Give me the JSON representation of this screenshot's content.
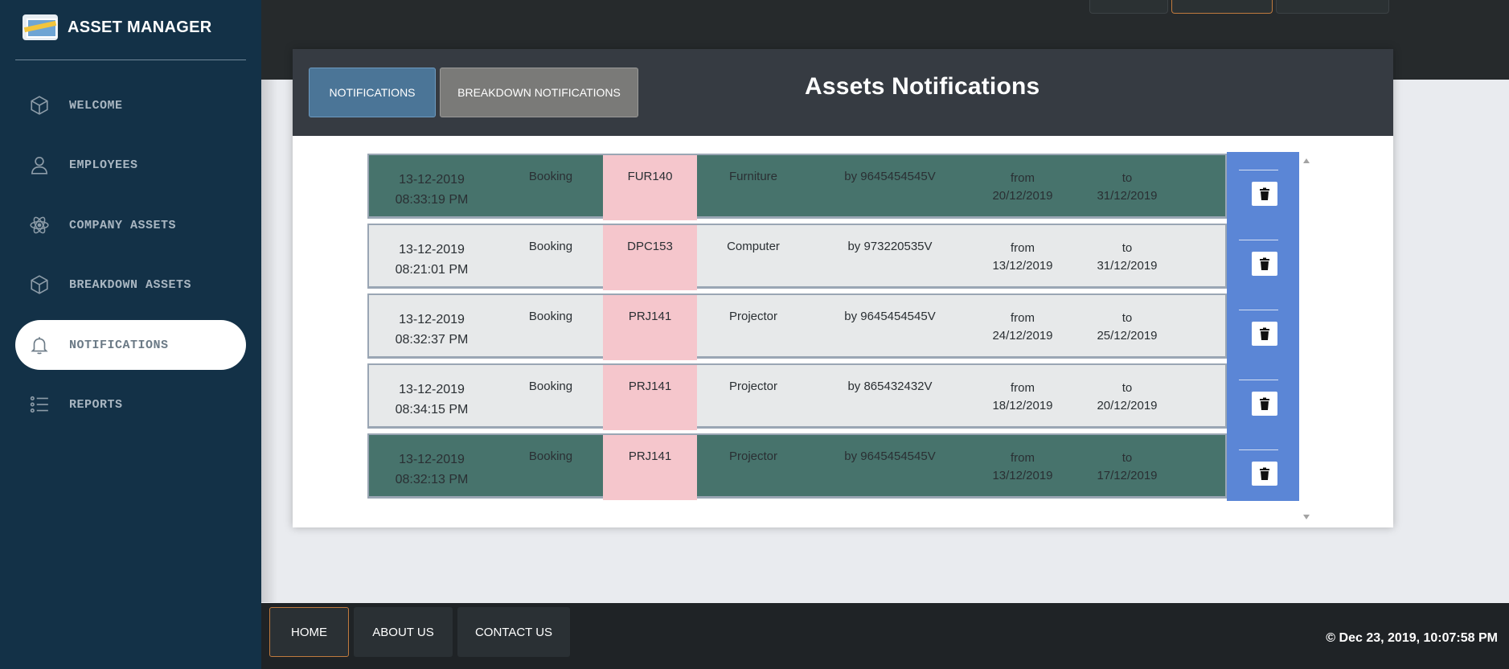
{
  "app": {
    "title": "ASSET MANAGER"
  },
  "sidebar": {
    "items": [
      {
        "label": "WELCOME",
        "icon": "cube-icon"
      },
      {
        "label": "EMPLOYEES",
        "icon": "user-icon"
      },
      {
        "label": "COMPANY ASSETS",
        "icon": "atom-icon"
      },
      {
        "label": "BREAKDOWN ASSETS",
        "icon": "cube-icon"
      },
      {
        "label": "NOTIFICATIONS",
        "icon": "bell-icon",
        "active": true
      },
      {
        "label": "REPORTS",
        "icon": "list-icon"
      }
    ]
  },
  "header": {
    "tabs": [
      {
        "label": "NOTIFICATIONS",
        "active": true
      },
      {
        "label": "BREAKDOWN NOTIFICATIONS"
      }
    ],
    "title": "Assets Notifications"
  },
  "notifications": [
    {
      "date": "13-12-2019",
      "time": "08:33:19 PM",
      "type": "Booking",
      "code": "FUR140",
      "category": "Furniture",
      "by": "by 9645454545V",
      "from_label": "from",
      "from_date": "20/12/2019",
      "to_label": "to",
      "to_date": "31/12/2019",
      "style": "green"
    },
    {
      "date": "13-12-2019",
      "time": "08:21:01 PM",
      "type": "Booking",
      "code": "DPC153",
      "category": "Computer",
      "by": "by 973220535V",
      "from_label": "from",
      "from_date": "13/12/2019",
      "to_label": "to",
      "to_date": "31/12/2019",
      "style": "light"
    },
    {
      "date": "13-12-2019",
      "time": "08:32:37 PM",
      "type": "Booking",
      "code": "PRJ141",
      "category": "Projector",
      "by": "by 9645454545V",
      "from_label": "from",
      "from_date": "24/12/2019",
      "to_label": "to",
      "to_date": "25/12/2019",
      "style": "light"
    },
    {
      "date": "13-12-2019",
      "time": "08:34:15 PM",
      "type": "Booking",
      "code": "PRJ141",
      "category": "Projector",
      "by": "by 865432432V",
      "from_label": "from",
      "from_date": "18/12/2019",
      "to_label": "to",
      "to_date": "20/12/2019",
      "style": "light"
    },
    {
      "date": "13-12-2019",
      "time": "08:32:13 PM",
      "type": "Booking",
      "code": "PRJ141",
      "category": "Projector",
      "by": "by 9645454545V",
      "from_label": "from",
      "from_date": "13/12/2019",
      "to_label": "to",
      "to_date": "17/12/2019",
      "style": "green"
    }
  ],
  "footer": {
    "home_label": "HOME",
    "about_label": "ABOUT US",
    "contact_label": "CONTACT US",
    "copyright": "© Dec 23, 2019, 10:07:58 PM"
  },
  "colors": {
    "sidebar_bg": "#133147",
    "row_green": "#47736c",
    "row_light": "#e7e9ea",
    "code_cell": "#f5c6cc",
    "action_col": "#5b86d6",
    "tab_active": "#4b7597",
    "tab_inactive": "#7a7a78"
  }
}
